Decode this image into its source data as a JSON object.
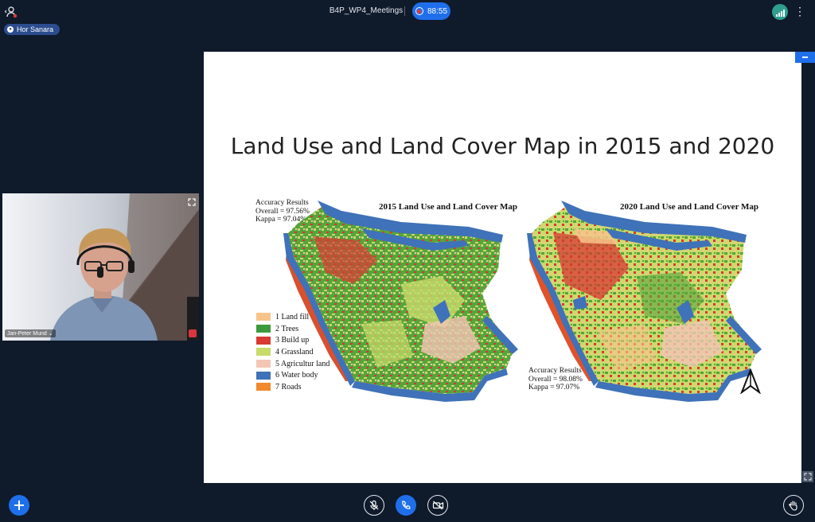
{
  "header": {
    "meeting_name": "B4P_WP4_Meetings",
    "timer": "88:55",
    "speaker_name": "Hor Sanara"
  },
  "participant": {
    "name": "Jan-Peter Mund",
    "name_suffix": "⌄"
  },
  "slide": {
    "title": "Land Use and Land Cover Map in 2015 and 2020",
    "map_2015": {
      "title": "2015 Land Use and Land Cover Map",
      "accuracy_heading": "Accuracy Results",
      "overall": "Overall  = 97.56%",
      "kappa": "Kappa  = 97.04%"
    },
    "map_2020": {
      "title": "2020 Land Use and Land Cover Map",
      "accuracy_heading": "Accuracy Results",
      "overall": "Overall  = 98.08%",
      "kappa": "Kappa  = 97.07%"
    },
    "legend": [
      {
        "label": "1 Land fill",
        "color": "#f6c48a"
      },
      {
        "label": "2 Trees",
        "color": "#3c9a3c"
      },
      {
        "label": "3 Build up",
        "color": "#d83a33"
      },
      {
        "label": "4 Grassland",
        "color": "#c7db6a"
      },
      {
        "label": "5 Agricultur land",
        "color": "#f2c6b4"
      },
      {
        "label": "6 Water body",
        "color": "#3f72b8"
      },
      {
        "label": "7 Roads",
        "color": "#f08a2c"
      }
    ]
  },
  "colors": {
    "background": "#0f1a2b",
    "accent": "#1f6feb",
    "connection": "#2f9e8f",
    "recording": "#e53935"
  },
  "icons": {
    "users": "users-icon",
    "mic_off": "mic-off-icon",
    "phone": "phone-icon",
    "camera_off": "camera-off-icon",
    "hand": "hand-icon",
    "plus": "plus-icon",
    "north_arrow": "north-arrow-icon"
  }
}
